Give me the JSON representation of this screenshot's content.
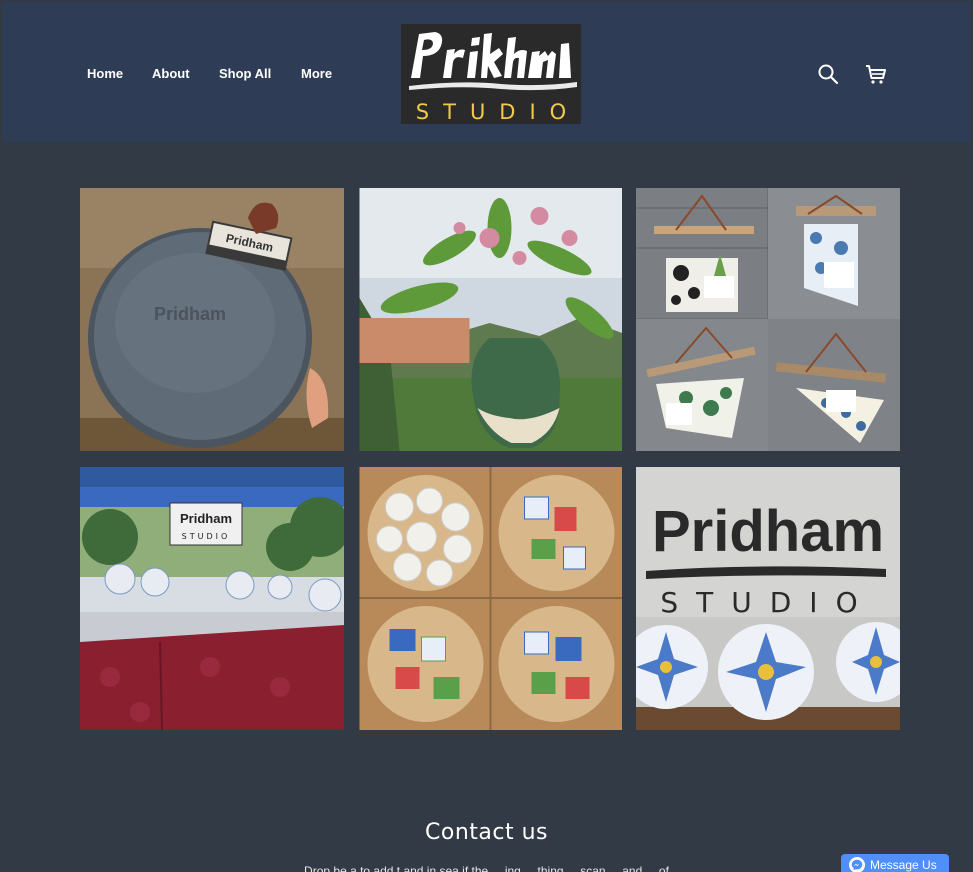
{
  "header": {
    "nav": [
      {
        "label": "Home"
      },
      {
        "label": "About"
      },
      {
        "label": "Shop All"
      },
      {
        "label": "More"
      }
    ],
    "logo": {
      "wordmark": "Pridham",
      "subtitle": "STUDIO"
    },
    "icons": [
      "search-icon",
      "cart-icon"
    ]
  },
  "gallery": {
    "images": [
      {
        "name": "stamp-on-clay-slab"
      },
      {
        "name": "vase-with-flowers"
      },
      {
        "name": "hanging-planters-collage"
      },
      {
        "name": "market-booth"
      },
      {
        "name": "ceramic-tiles-collage"
      },
      {
        "name": "studio-sign-with-plates"
      }
    ],
    "booth_sign": {
      "wordmark": "Pridham",
      "subtitle": "STUDIO"
    },
    "wall_sign": {
      "wordmark": "Pridham",
      "subtitle": "STUDIO"
    }
  },
  "contact": {
    "title": "Contact us",
    "subtitle": "Drop be a to add t and in sea if the ... ing ... thing ... scan ... and ... of"
  },
  "messenger": {
    "label": "Message Us"
  },
  "colors": {
    "header_bg": "#2f3c56",
    "page_bg": "#323b45",
    "logo_bg": "#2a2a2a",
    "logo_accent": "#f2c94c",
    "messenger": "#4f8ff7"
  }
}
